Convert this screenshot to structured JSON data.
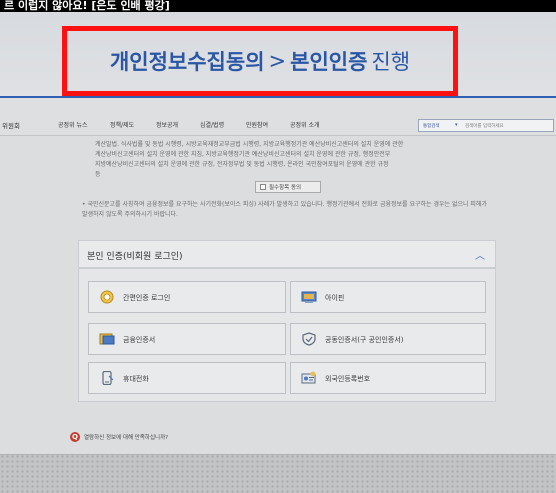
{
  "caption": "르 이럽지 않아요! [은도 인배 평강]",
  "step_banner": {
    "part1": "개인정보수집동의",
    "separator": ">",
    "part2": "본인인증",
    "action": "진행"
  },
  "navbar": {
    "org_name": "위원회",
    "items": [
      "공정위 뉴스",
      "정책/제도",
      "정보공개",
      "심결/법령",
      "민원참여",
      "공정위 소개"
    ],
    "search_select": "통합검색",
    "search_placeholder": "검색어를 입력하세요"
  },
  "terms": {
    "lines": [
      "계산발법. 식사법률 및 동법 시행령, 시방교육재정교부금법 시행령, 지방교육행정기관 예산낭비신고센터의 설치 운영에 관한",
      "계산낭비신고센터의 설치 운영에 관한 지침, 지방교육행정기관 예산낭비신고센터의 설치 운영에 관한 규정, 행정안전부",
      "지방예산낭비신고센터의 설치 운영에 관한 규정, 전자정부법 및 동법 시행령, 온라인 국민참여포털의 운영에 관한 규정",
      "등"
    ],
    "consent_label": "필수항목 동의"
  },
  "notice_text": "• 국민신문고를 사칭하여 금융정보를 요구하는 사기전화(보이스 피싱) 사례가 발생하고 있습니다. 행정기관에서 전화로 금융정보를 요구하는 경우는 없으니 피해가 발생하지 않도록 주의하시기 바랍니다.",
  "auth": {
    "title": "본인 인증(비회원 로그인)",
    "options": [
      {
        "label": "간편인증 로그인",
        "icon": "simple-auth-icon"
      },
      {
        "label": "아이핀",
        "icon": "ipin-icon"
      },
      {
        "label": "금융인증서",
        "icon": "financial-cert-icon"
      },
      {
        "label": "공동인증서(구 공인인증서)",
        "icon": "joint-cert-icon"
      },
      {
        "label": "휴대전화",
        "icon": "mobile-phone-icon"
      },
      {
        "label": "외국인등록번호",
        "icon": "foreigner-id-icon"
      }
    ]
  },
  "feedback": {
    "badge": "Q",
    "text": "열람하신 정보에 대해 만족하십니까?"
  },
  "colors": {
    "highlight_border": "#ff1111",
    "brand_blue": "#2a56a6"
  }
}
